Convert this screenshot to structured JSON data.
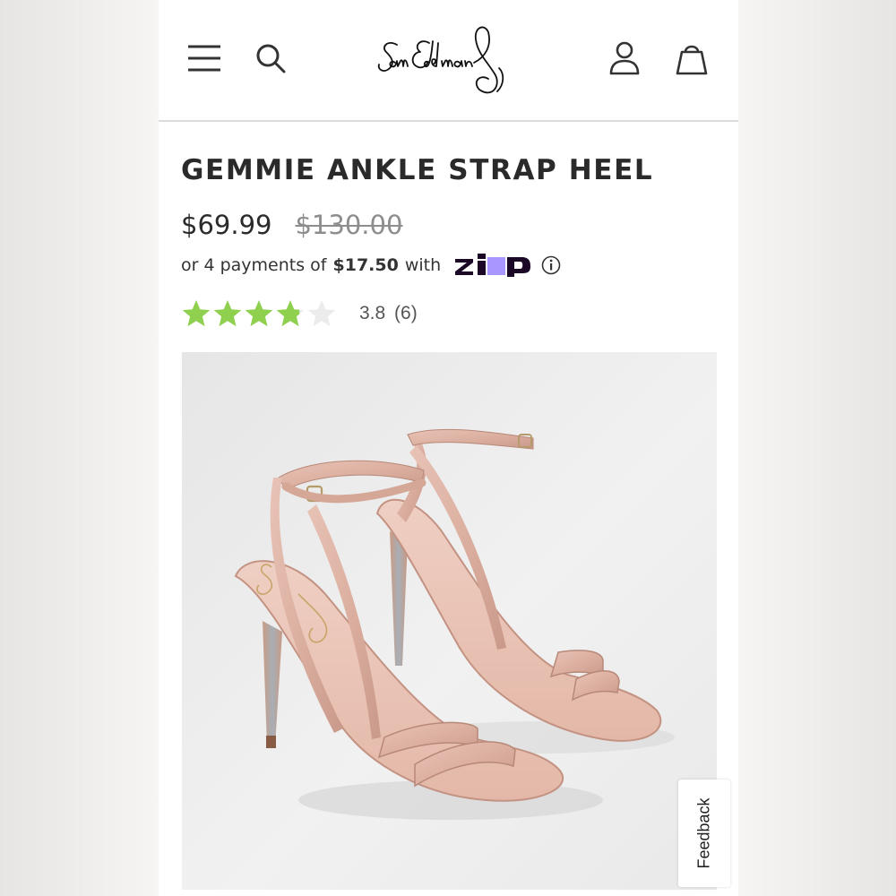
{
  "brand": {
    "logo_name": "sam-edelman-logo",
    "logo_text": "Sam Edelman"
  },
  "header": {
    "icons": [
      "menu-icon",
      "search-icon",
      "account-icon",
      "shopping-bag-icon"
    ]
  },
  "product": {
    "title": "GEMMIE ANKLE STRAP HEEL",
    "sale_price": "$69.99",
    "original_price": "$130.00",
    "installments": {
      "prefix": "or 4 payments of",
      "amount": "$17.50",
      "suffix": "with",
      "provider_name": "Zip",
      "provider_logo_text": "zip"
    },
    "rating": {
      "value": 3.8,
      "max": 5,
      "display": "3.8",
      "count_display": "(6)"
    },
    "image": {
      "description_icon": "product-photo"
    }
  },
  "feedback": {
    "label": "Feedback"
  },
  "colors": {
    "star_filled": "#8fd14f",
    "star_empty": "#ececec",
    "zip_purple": "#a996ff",
    "zip_navy": "#1a0826",
    "text_dark": "#2b2b2b",
    "text_muted": "#8d8d8d"
  }
}
